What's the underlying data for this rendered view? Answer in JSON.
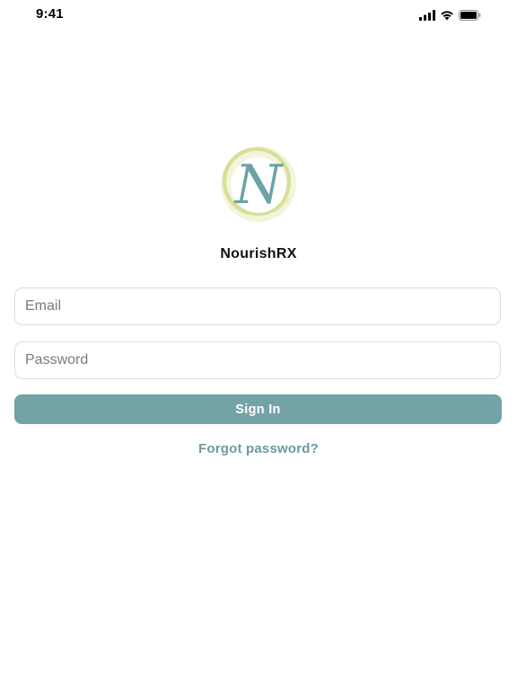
{
  "status_bar": {
    "time": "9:41",
    "icons": [
      "cellular-signal-icon",
      "wifi-icon",
      "battery-icon"
    ]
  },
  "app": {
    "logo_letter": "N",
    "name": "NourishRX"
  },
  "form": {
    "email_placeholder": "Email",
    "email_value": "",
    "password_placeholder": "Password",
    "password_value": "",
    "sign_in_label": "Sign In",
    "forgot_password_label": "Forgot password?"
  },
  "colors": {
    "accent": "#73a3a6",
    "link": "#6a9b9e",
    "logo_ring_light": "#eef0c8",
    "logo_ring_dark": "#d4dc8a",
    "logo_letter": "#6aa3a6"
  }
}
